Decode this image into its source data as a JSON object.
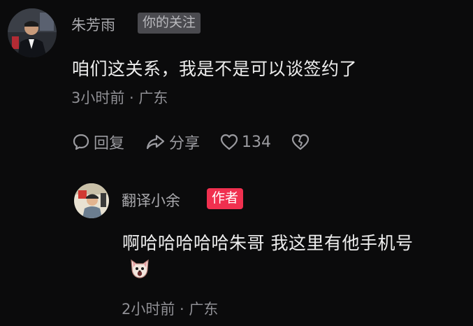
{
  "comment": {
    "username": "朱芳雨",
    "badge": "你的关注",
    "text": "咱们这关系，我是不是可以谈签约了",
    "meta": "3小时前 · 广东",
    "actions": {
      "reply_label": "回复",
      "share_label": "分享",
      "like_count": "134"
    }
  },
  "reply": {
    "username": "翻译小余",
    "badge": "作者",
    "text": "啊哈哈哈哈哈朱哥 我这里有他手机号",
    "emoji": "dog-face-emoji",
    "meta": "2小时前 · 广东"
  },
  "colors": {
    "background": "#0b0b0c",
    "author_badge": "#f0304f",
    "follow_badge": "#4a4a4f"
  }
}
